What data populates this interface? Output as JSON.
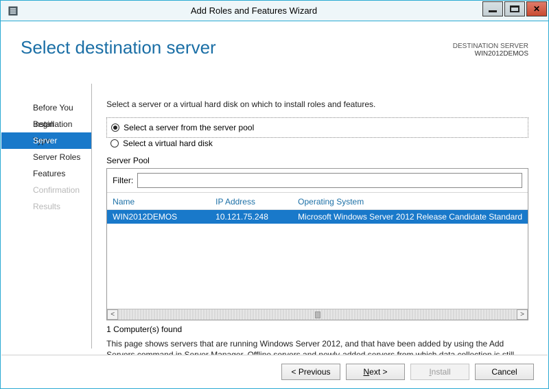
{
  "window": {
    "title": "Add Roles and Features Wizard"
  },
  "header": {
    "page_title": "Select destination server",
    "dest_label": "DESTINATION SERVER",
    "dest_value": "WIN2012DEMOS"
  },
  "sidebar": {
    "items": [
      {
        "label": "Before You Begin",
        "state": "normal"
      },
      {
        "label": "Installation Type",
        "state": "normal"
      },
      {
        "label": "Server Selection",
        "state": "selected"
      },
      {
        "label": "Server Roles",
        "state": "normal"
      },
      {
        "label": "Features",
        "state": "normal"
      },
      {
        "label": "Confirmation",
        "state": "disabled"
      },
      {
        "label": "Results",
        "state": "disabled"
      }
    ]
  },
  "content": {
    "instruction": "Select a server or a virtual hard disk on which to install roles and features.",
    "radio_pool": "Select a server from the server pool",
    "radio_vhd": "Select a virtual hard disk",
    "pool_label": "Server Pool",
    "filter_label": "Filter:",
    "columns": {
      "name": "Name",
      "ip": "IP Address",
      "os": "Operating System"
    },
    "rows": [
      {
        "name": "WIN2012DEMOS",
        "ip": "10.121.75.248",
        "os": "Microsoft Windows Server 2012 Release Candidate Standard"
      }
    ],
    "found": "1 Computer(s) found",
    "explain": "This page shows servers that are running Windows Server 2012, and that have been added by using the Add Servers command in Server Manager. Offline servers and newly-added servers from which data collection is still incomplete are not shown."
  },
  "buttons": {
    "previous": "< Previous",
    "next_pre": "N",
    "next_post": "ext >",
    "install_pre": "I",
    "install_post": "nstall",
    "cancel": "Cancel"
  }
}
